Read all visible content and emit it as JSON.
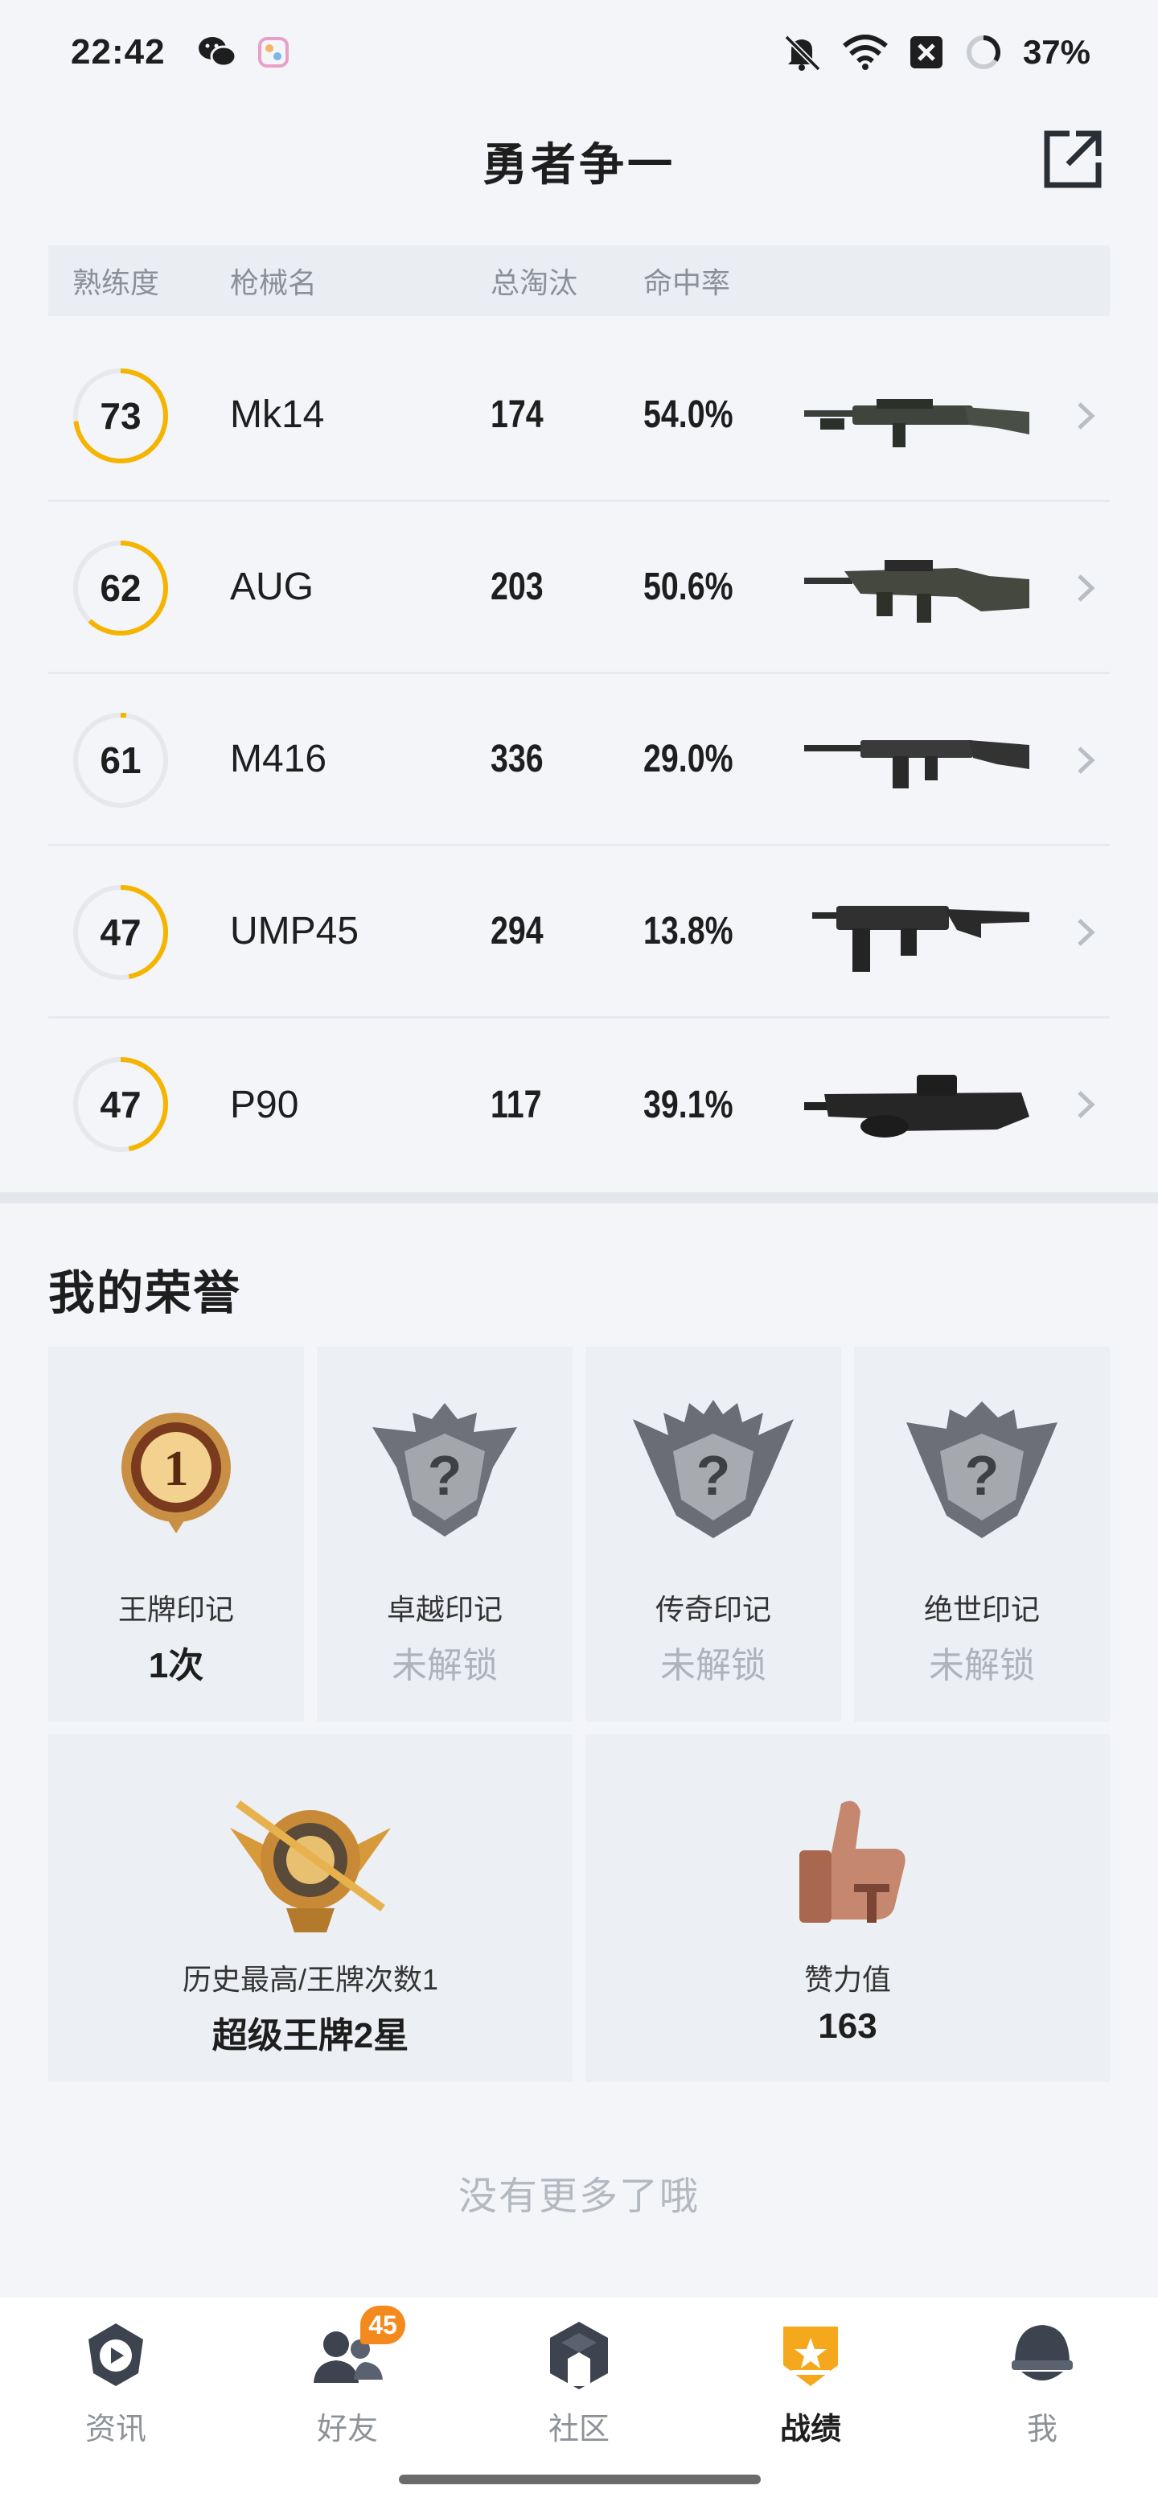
{
  "status_bar": {
    "time": "22:42",
    "battery": "37%",
    "icons_left": [
      "wechat-icon",
      "app-icon"
    ],
    "icons_right": [
      "mute-icon",
      "wifi-icon",
      "close-box-icon",
      "battery-ring-icon"
    ]
  },
  "header": {
    "title": "勇者争一",
    "share_icon": "share-external-icon"
  },
  "table": {
    "headers": {
      "proficiency": "熟练度",
      "weapon": "枪械名",
      "kills": "总淘汰",
      "accuracy": "命中率"
    },
    "rows": [
      {
        "proficiency": "73",
        "proficiency_fraction": 0.73,
        "weapon": "Mk14",
        "kills": "174",
        "accuracy": "54.0%"
      },
      {
        "proficiency": "62",
        "proficiency_fraction": 0.62,
        "weapon": "AUG",
        "kills": "203",
        "accuracy": "50.6%"
      },
      {
        "proficiency": "61",
        "proficiency_fraction": 0.02,
        "weapon": "M416",
        "kills": "336",
        "accuracy": "29.0%"
      },
      {
        "proficiency": "47",
        "proficiency_fraction": 0.47,
        "weapon": "UMP45",
        "kills": "294",
        "accuracy": "13.8%"
      },
      {
        "proficiency": "47",
        "proficiency_fraction": 0.47,
        "weapon": "P90",
        "kills": "117",
        "accuracy": "39.1%"
      }
    ]
  },
  "honors": {
    "title": "我的荣誉",
    "badges": [
      {
        "label": "王牌印记",
        "value": "1次",
        "locked": false
      },
      {
        "label": "卓越印记",
        "value": "未解锁",
        "locked": true
      },
      {
        "label": "传奇印记",
        "value": "未解锁",
        "locked": true
      },
      {
        "label": "绝世印记",
        "value": "未解锁",
        "locked": true
      }
    ],
    "stats": [
      {
        "label": "历史最高/王牌次数1",
        "value": "超级王牌2星"
      },
      {
        "label": "赞力值",
        "value": "163"
      }
    ]
  },
  "end_text": "没有更多了哦",
  "colors": {
    "accent": "#f5b400",
    "ring_track": "#e6e8ec",
    "locked_text": "#aeb3ba"
  },
  "bottom_nav": {
    "items": [
      {
        "label": "资讯",
        "icon": "news-icon",
        "active": false
      },
      {
        "label": "好友",
        "icon": "friends-icon",
        "active": false,
        "badge": "45"
      },
      {
        "label": "社区",
        "icon": "community-icon",
        "active": false
      },
      {
        "label": "战绩",
        "icon": "record-badge-icon",
        "active": true
      },
      {
        "label": "我",
        "icon": "helmet-icon",
        "active": false
      }
    ]
  }
}
